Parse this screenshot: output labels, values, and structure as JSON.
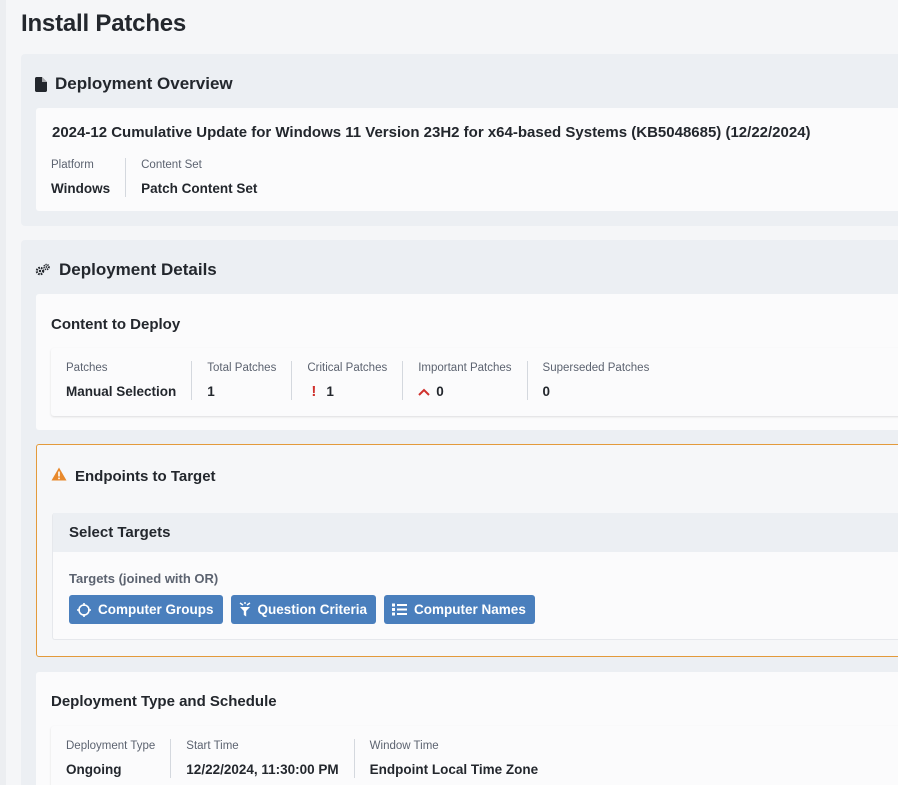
{
  "page": {
    "title": "Install Patches"
  },
  "overview": {
    "header": "Deployment Overview",
    "header_icon": "document-icon",
    "patch_title": "2024-12 Cumulative Update for Windows 11 Version 23H2 for x64-based Systems (KB5048685) (12/22/2024)",
    "fields": [
      {
        "label": "Platform",
        "value": "Windows"
      },
      {
        "label": "Content Set",
        "value": "Patch Content Set"
      }
    ]
  },
  "details": {
    "header": "Deployment Details",
    "header_icon": "gears-icon",
    "content": {
      "title": "Content to Deploy",
      "fields": [
        {
          "label": "Patches",
          "value": "Manual Selection"
        },
        {
          "label": "Total Patches",
          "value": "1"
        },
        {
          "label": "Critical Patches",
          "value": "1",
          "icon": "exclamation-icon"
        },
        {
          "label": "Important Patches",
          "value": "0",
          "icon": "chevron-up-icon"
        },
        {
          "label": "Superseded Patches",
          "value": "0"
        }
      ]
    },
    "endpoints": {
      "title": "Endpoints to Target",
      "icon": "warning-triangle-icon",
      "select_title": "Select Targets",
      "joined_label": "Targets (joined with OR)",
      "buttons": [
        {
          "label": "Computer Groups",
          "icon": "crosshair-icon"
        },
        {
          "label": "Question Criteria",
          "icon": "filter-icon"
        },
        {
          "label": "Computer Names",
          "icon": "list-icon"
        }
      ]
    },
    "schedule": {
      "title": "Deployment Type and Schedule",
      "fields": [
        {
          "label": "Deployment Type",
          "value": "Ongoing"
        },
        {
          "label": "Start Time",
          "value": "12/22/2024, 11:30:00 PM"
        },
        {
          "label": "Window Time",
          "value": "Endpoint Local Time Zone"
        }
      ]
    }
  },
  "colors": {
    "accent_button": "#4a7fbd",
    "warning_border": "#e39a3b",
    "critical_red": "#d0312d"
  }
}
